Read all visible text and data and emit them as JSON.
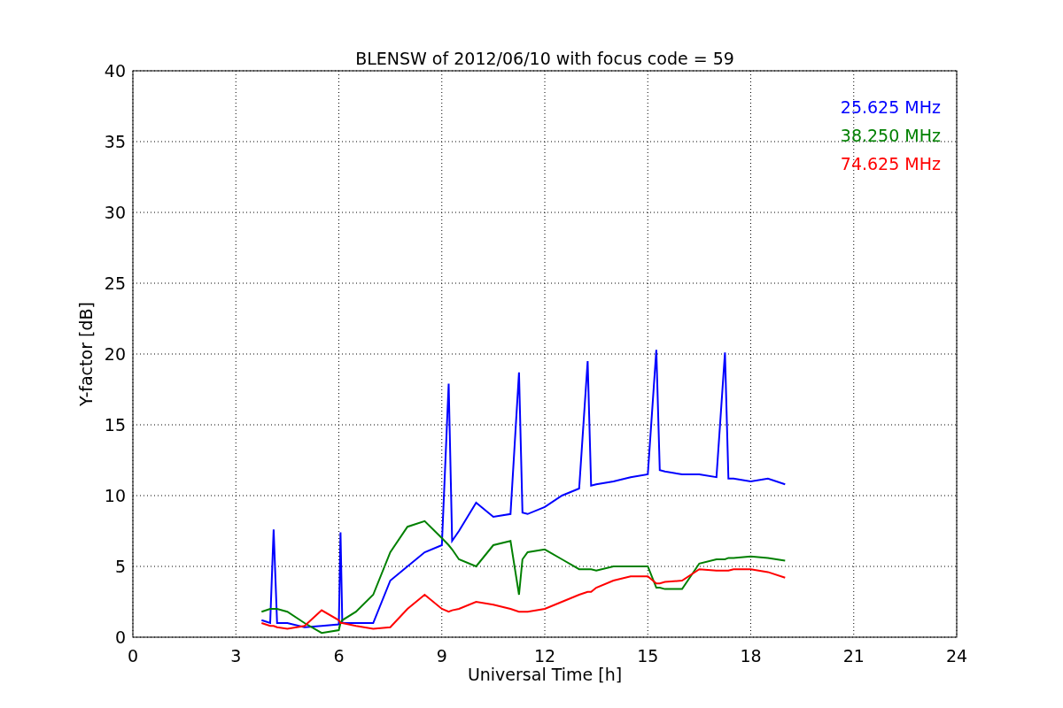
{
  "figure": {
    "chart_data": {
      "type": "line",
      "title": "BLENSW of 2012/06/10 with focus code = 59",
      "xlabel": "Universal Time [h]",
      "ylabel": "Y-factor [dB]",
      "x": [
        3.75,
        4.0,
        4.1,
        4.2,
        4.5,
        5.0,
        5.5,
        6.0,
        6.05,
        6.1,
        6.5,
        7.0,
        7.5,
        8.0,
        8.5,
        9.0,
        9.2,
        9.3,
        9.5,
        10.0,
        10.5,
        11.0,
        11.25,
        11.35,
        11.5,
        12.0,
        12.5,
        13.0,
        13.25,
        13.35,
        13.5,
        14.0,
        14.5,
        15.0,
        15.25,
        15.35,
        15.5,
        16.0,
        16.5,
        17.0,
        17.25,
        17.35,
        17.5,
        18.0,
        18.5,
        19.0
      ],
      "series": [
        {
          "name": "25.625 MHz",
          "color": "#0000ff",
          "values": [
            1.2,
            1.0,
            7.6,
            1.0,
            1.0,
            0.7,
            0.8,
            0.9,
            7.4,
            1.0,
            1.0,
            1.0,
            4.0,
            5.0,
            6.0,
            6.5,
            17.9,
            6.8,
            7.5,
            9.5,
            8.5,
            8.7,
            18.7,
            8.8,
            8.7,
            9.2,
            10.0,
            10.5,
            19.5,
            10.7,
            10.8,
            11.0,
            11.3,
            11.5,
            20.3,
            11.8,
            11.7,
            11.5,
            11.5,
            11.3,
            20.1,
            11.2,
            11.2,
            11.0,
            11.2,
            10.8
          ]
        },
        {
          "name": "38.250 MHz",
          "color": "#008000",
          "values": [
            1.8,
            2.0,
            2.0,
            2.0,
            1.8,
            1.0,
            0.3,
            0.5,
            1.0,
            1.2,
            1.8,
            3.0,
            6.0,
            7.8,
            8.2,
            7.0,
            6.5,
            6.2,
            5.5,
            5.0,
            6.5,
            6.8,
            3.0,
            5.5,
            6.0,
            6.2,
            5.5,
            4.8,
            4.8,
            4.8,
            4.7,
            5.0,
            5.0,
            5.0,
            3.5,
            3.5,
            3.4,
            3.4,
            5.2,
            5.5,
            5.5,
            5.6,
            5.6,
            5.7,
            5.6,
            5.4
          ]
        },
        {
          "name": "74.625 MHz",
          "color": "#ff0000",
          "values": [
            1.0,
            0.8,
            0.8,
            0.7,
            0.6,
            0.8,
            1.9,
            1.2,
            1.0,
            1.0,
            0.8,
            0.6,
            0.7,
            2.0,
            3.0,
            2.0,
            1.8,
            1.9,
            2.0,
            2.5,
            2.3,
            2.0,
            1.8,
            1.8,
            1.8,
            2.0,
            2.5,
            3.0,
            3.2,
            3.2,
            3.5,
            4.0,
            4.3,
            4.3,
            3.8,
            3.8,
            3.9,
            4.0,
            4.8,
            4.7,
            4.7,
            4.7,
            4.8,
            4.8,
            4.6,
            4.2
          ]
        }
      ],
      "grid": true,
      "xlim": [
        0,
        24
      ],
      "ylim": [
        0,
        40
      ],
      "xticks": [
        0,
        3,
        6,
        9,
        12,
        15,
        18,
        21,
        24
      ],
      "yticks": [
        0,
        5,
        10,
        15,
        20,
        25,
        30,
        35,
        40
      ]
    }
  }
}
